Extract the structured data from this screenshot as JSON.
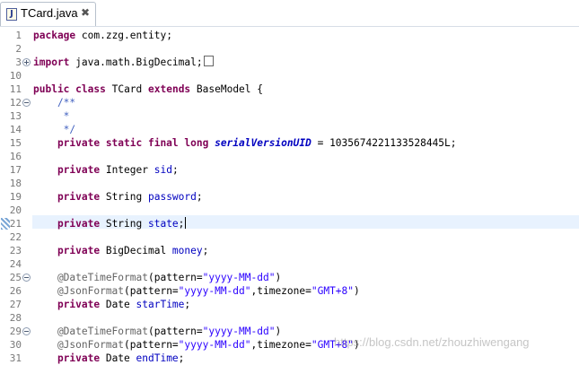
{
  "tab": {
    "title": "TCard.java",
    "icon": "J",
    "close_icon": "✖"
  },
  "line_numbers": [
    "1",
    "2",
    "3",
    "10",
    "11",
    "12",
    "13",
    "14",
    "15",
    "16",
    "17",
    "18",
    "19",
    "20",
    "21",
    "22",
    "23",
    "24",
    "25",
    "26",
    "27",
    "28",
    "29",
    "30",
    "31"
  ],
  "code": {
    "l1_kw": "package",
    "l1_rest": " com.zzg.entity;",
    "l3_kw": "import",
    "l3_rest": " java.math.BigDecimal;",
    "l11_kw1": "public",
    "l11_kw2": "class",
    "l11_mid": " TCard ",
    "l11_kw3": "extends",
    "l11_rest": " BaseModel {",
    "l12": "    /**",
    "l13": "     *",
    "l14": "     */",
    "l15_kw": "    private static final long ",
    "l15_field": "serialVersionUID",
    "l15_rest": " = 1035674221133528445L;",
    "l17_kw": "    private",
    "l17_type": " Integer ",
    "l17_field": "sid",
    "l17_end": ";",
    "l19_kw": "    private",
    "l19_type": " String ",
    "l19_field": "password",
    "l19_end": ";",
    "l21_kw": "    private",
    "l21_type": " String ",
    "l21_field": "state",
    "l21_end": ";",
    "l23_kw": "    private",
    "l23_type": " BigDecimal ",
    "l23_field": "money",
    "l23_end": ";",
    "l25_ann": "    @DateTimeFormat",
    "l25_a": "(pattern=",
    "l25_str": "\"yyyy-MM-dd\"",
    "l25_b": ")",
    "l26_ann": "    @JsonFormat",
    "l26_a": "(pattern=",
    "l26_str": "\"yyyy-MM-dd\"",
    "l26_b": ",timezone=",
    "l26_str2": "\"GMT+8\"",
    "l26_c": ")",
    "l27_kw": "    private",
    "l27_type": " Date ",
    "l27_field": "starTime",
    "l27_end": ";",
    "l29_ann": "    @DateTimeFormat",
    "l29_a": "(pattern=",
    "l29_str": "\"yyyy-MM-dd\"",
    "l29_b": ")",
    "l30_ann": "    @JsonFormat",
    "l30_a": "(pattern=",
    "l30_str": "\"yyyy-MM-dd\"",
    "l30_b": ",timezone=",
    "l30_str2": "\"GMT+8\"",
    "l30_c": ")",
    "l31_kw": "    private",
    "l31_type": " Date ",
    "l31_field": "endTime",
    "l31_end": ";"
  },
  "watermark": "https://blog.csdn.net/zhouzhiwengang",
  "colors": {
    "keyword": "#7f0055",
    "field": "#0000c0",
    "comment": "#3f5fbf",
    "annotation": "#646464",
    "string": "#2a00ff",
    "current_line": "#e8f2fe"
  }
}
